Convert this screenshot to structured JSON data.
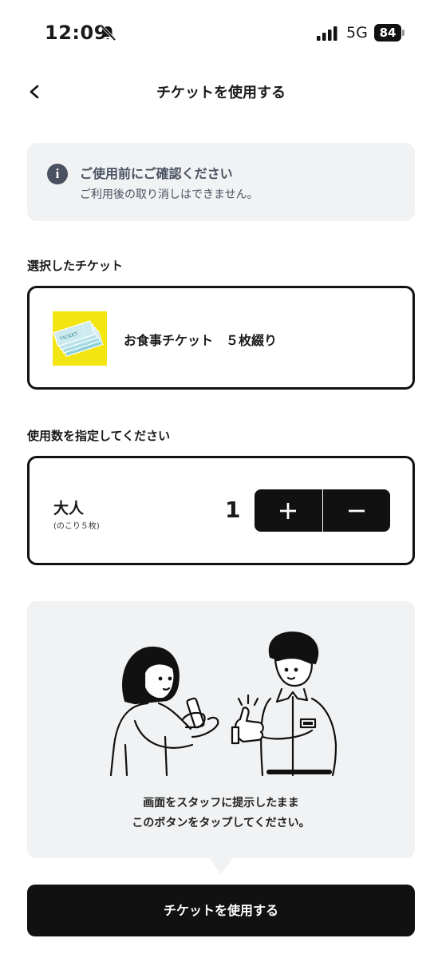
{
  "status_bar": {
    "time": "12:09",
    "network": "5G",
    "battery": "84",
    "icons": [
      "bell-slash-icon",
      "signal-icon",
      "battery-icon"
    ]
  },
  "nav": {
    "title": "チケットを使用する",
    "back_icon": "chevron-left-icon"
  },
  "notice": {
    "icon": "info-icon",
    "icon_glyph": "i",
    "title": "ご使用前にご確認ください",
    "text": "ご利用後の取り消しはできません。"
  },
  "selected_ticket": {
    "section_label": "選択したチケット",
    "name": "お食事チケット　５枚綴り",
    "thumbnail_text": "TICKET"
  },
  "quantity": {
    "section_label": "使用数を指定してください",
    "label": "大人",
    "remaining": "(のこり５枚)",
    "value": "1",
    "increment_icon": "plus-icon",
    "decrement_icon": "minus-icon"
  },
  "instruction": {
    "line1": "画面をスタッフに提示したまま",
    "line2": "このボタンをタップしてください。"
  },
  "primary_button": {
    "label": "チケットを使用する"
  },
  "colors": {
    "accent": "#111111",
    "panel": "#f1f2f4",
    "info_text": "#4a5160",
    "thumbnail_bg": "#f3e511"
  }
}
